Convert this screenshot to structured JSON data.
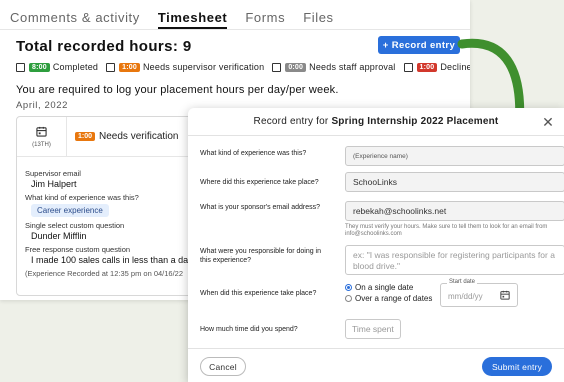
{
  "tabs": [
    {
      "label": "Comments & activity"
    },
    {
      "label": "Timesheet"
    },
    {
      "label": "Forms"
    },
    {
      "label": "Files"
    }
  ],
  "active_tab": "Timesheet",
  "total_hours": "Total recorded hours: 9",
  "record_button": "+ Record entry",
  "legend": [
    {
      "badge": "8:00",
      "label": "Completed",
      "color": "#2e9e3e"
    },
    {
      "badge": "1:00",
      "label": "Needs supervisor verification",
      "color": "#e8770e"
    },
    {
      "badge": "0:00",
      "label": "Needs staff approval",
      "color": "#8a8a8a"
    },
    {
      "badge": "1:00",
      "label": "Declined",
      "color": "#d2382c"
    }
  ],
  "intro": "You are required to log your placement hours per day/per week.",
  "month": "April, 2022",
  "entry": {
    "day": "(13TH)",
    "badge": "1:00",
    "status": "Needs verification",
    "supervisor_label": "Supervisor email",
    "supervisor_value": "Jim Halpert",
    "kind_label": "What kind of experience was this?",
    "kind_value": "Career experience",
    "single_label": "Single select custom question",
    "single_value": "Dunder Mifflin",
    "free_label": "Free response custom question",
    "free_value": "I made 100 sales calls in less than a day b",
    "recorded": "(Experience Recorded at 12:35 pm on 04/16/22"
  },
  "modal": {
    "title_prefix": "Record entry for",
    "title_bold": "Spring Internship 2022 Placement",
    "close": "✕",
    "q1": "What kind of experience was this?",
    "q1_placeholder": "(Experience name)",
    "q2": "Where did this experience take place?",
    "q2_value": "SchooLinks",
    "q3": "What is your sponsor's email address?",
    "q3_value": "rebekah@schoolinks.net",
    "q3_hint": "They must verify your hours. Make sure to tell them to look for an email from info@schoolinks.com",
    "q4": "What were you responsible for doing in this experience?",
    "q4_placeholder": "ex: \"I was responsible for registering participants for a blood drive.\"",
    "q5": "When did this experience take place?",
    "q5_opt1": "On a single date",
    "q5_opt2": "Over a range of dates",
    "start_label": "Start date",
    "start_placeholder": "mm/dd/yy",
    "q6": "How much time did you spend?",
    "q6_placeholder": "Time spent",
    "cancel": "Cancel",
    "submit": "Submit entry"
  },
  "colors": {
    "accent": "#2a6fdb",
    "arrow": "#3f8f2e"
  },
  "icons": {
    "calendar": "calendar-icon",
    "close": "close-icon",
    "arrow": "curved-arrow-icon"
  }
}
